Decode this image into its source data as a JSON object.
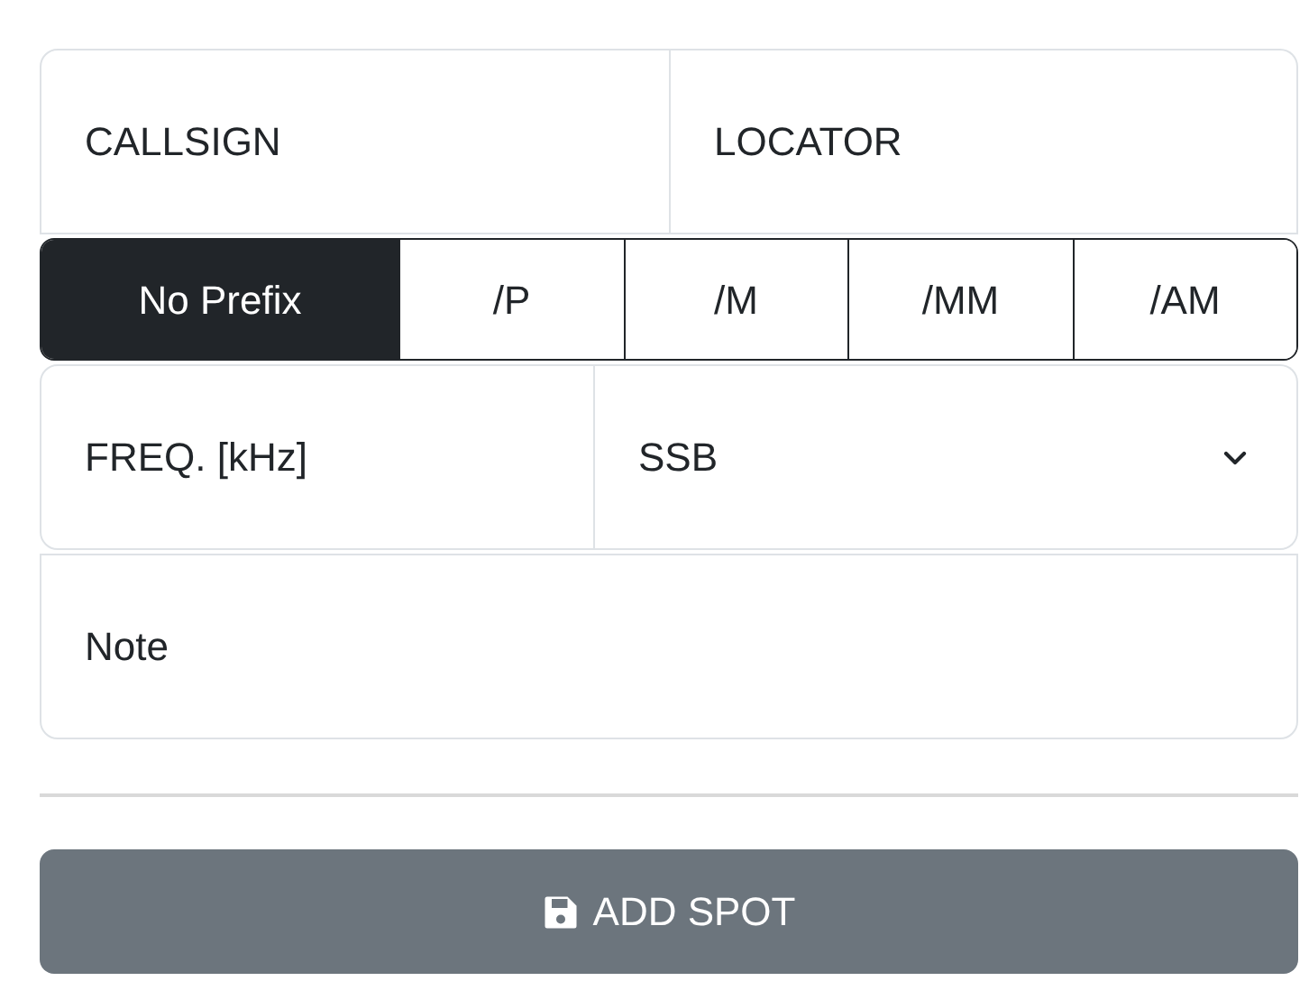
{
  "callsign": {
    "placeholder": "CALLSIGN"
  },
  "locator": {
    "placeholder": "LOCATOR"
  },
  "prefixes": [
    {
      "label": "No Prefix",
      "selected": true
    },
    {
      "label": "/P",
      "selected": false
    },
    {
      "label": "/M",
      "selected": false
    },
    {
      "label": "/MM",
      "selected": false
    },
    {
      "label": "/AM",
      "selected": false
    }
  ],
  "frequency": {
    "placeholder": "FREQ. [kHz]"
  },
  "mode": {
    "value": "SSB"
  },
  "note": {
    "placeholder": "Note"
  },
  "submit": {
    "label": "ADD SPOT"
  }
}
